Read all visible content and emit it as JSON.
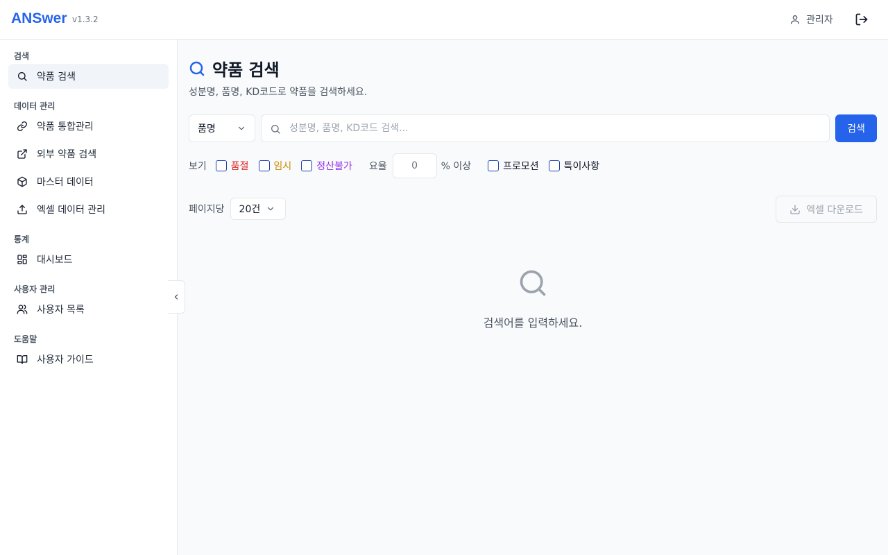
{
  "header": {
    "brand": "ANSwer",
    "version": "v1.3.2",
    "user_name": "관리자"
  },
  "sidebar": {
    "sections": [
      {
        "label": "검색",
        "items": [
          {
            "label": "약품 검색",
            "icon": "search-icon",
            "active": true
          }
        ]
      },
      {
        "label": "데이터 관리",
        "items": [
          {
            "label": "약품 통합관리",
            "icon": "link-icon"
          },
          {
            "label": "외부 약품 검색",
            "icon": "external-link-icon"
          },
          {
            "label": "마스터 데이터",
            "icon": "package-icon"
          },
          {
            "label": "엑셀 데이터 관리",
            "icon": "upload-icon"
          }
        ]
      },
      {
        "label": "통계",
        "items": [
          {
            "label": "대시보드",
            "icon": "dashboard-icon"
          }
        ]
      },
      {
        "label": "사용자 관리",
        "items": [
          {
            "label": "사용자 목록",
            "icon": "users-icon"
          }
        ]
      },
      {
        "label": "도움말",
        "items": [
          {
            "label": "사용자 가이드",
            "icon": "book-icon"
          }
        ]
      }
    ]
  },
  "main": {
    "title": "약품 검색",
    "subtitle": "성분명, 품명, KD코드로 약품을 검색하세요.",
    "search_type": "품명",
    "search_placeholder": "성분명, 품명, KD코드 검색...",
    "search_value": "",
    "search_button": "검색",
    "filters": {
      "view_label": "보기",
      "soldout": "품절",
      "temp": "임시",
      "nosettle": "정산불가",
      "rate_label": "요율",
      "rate_value": "0",
      "rate_suffix": "% 이상",
      "promotion": "프로모션",
      "special": "특이사항"
    },
    "per_page_label": "페이지당",
    "per_page_value": "20건",
    "excel_download": "엑셀 다운로드",
    "empty_message": "검색어를 입력하세요."
  },
  "colors": {
    "accent": "#2563eb",
    "soldout": "#dc2626",
    "temp": "#ca8a04",
    "nosettle": "#9333ea"
  }
}
